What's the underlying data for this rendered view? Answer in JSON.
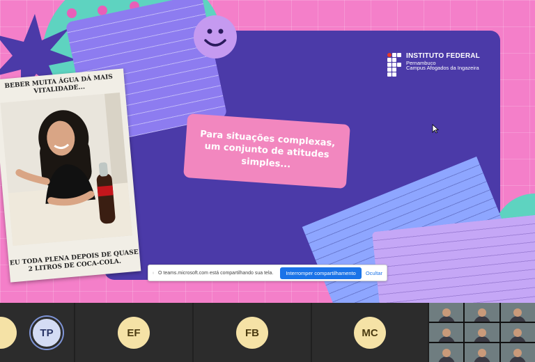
{
  "slide": {
    "logo": {
      "name": "INSTITUTO FEDERAL",
      "state": "Pernambuco",
      "campus": "Campus Afogados da Ingazeira"
    },
    "quote": "Para situações complexas, um conjunto de atitudes simples..."
  },
  "photo_card": {
    "caption_top": "BEBER MUITA ÁGUA DÁ MAIS VITALIDADE...",
    "caption_bottom": "EU TODA PLENA DEPOIS DE QUASE 2 LITROS DE COCA-COLA."
  },
  "share_bar": {
    "message": "O teams.microsoft.com está compartilhando sua tela.",
    "stop_label": "Interromper compartilhamento",
    "hide_label": "Ocultar"
  },
  "participants": [
    {
      "initials": "TP",
      "speaking": true
    },
    {
      "initials": "EF",
      "speaking": false
    },
    {
      "initials": "FB",
      "speaking": false
    },
    {
      "initials": "MC",
      "speaking": false
    }
  ],
  "colors": {
    "slide_bg": "#f47fc9",
    "panel": "#4b3aa8",
    "teal": "#5ed3c0",
    "quote_box": "#f287bf",
    "share_button": "#1a73e8",
    "avatar": "#f5e2a6"
  }
}
